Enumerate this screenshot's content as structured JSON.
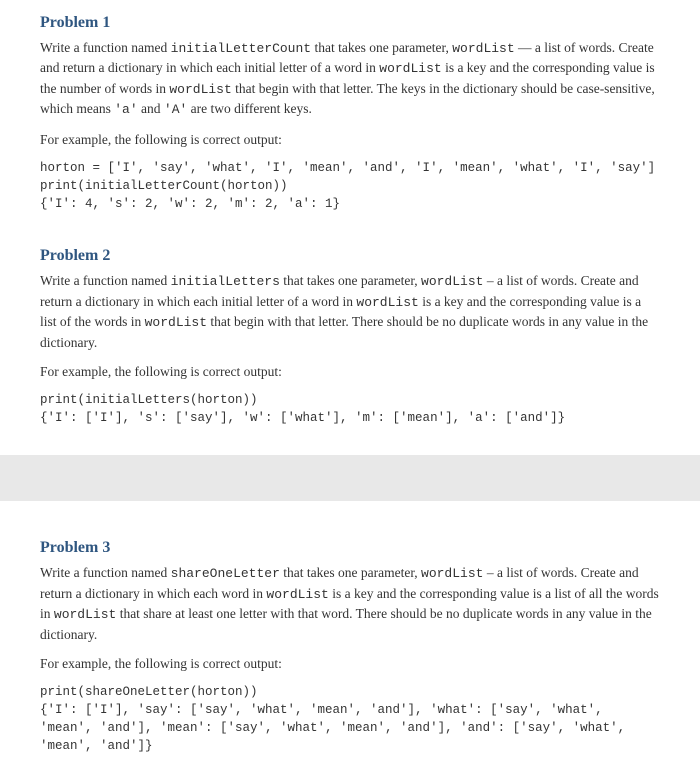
{
  "page1": {
    "problem1": {
      "title": "Problem 1",
      "text_a": "Write a function named ",
      "fn": "initialLetterCount",
      "text_b": " that takes one parameter, ",
      "param": "wordList",
      "text_c": " — a list of words. Create and return a dictionary in which each initial letter of a word in ",
      "param2": "wordList",
      "text_d": " is a key and the corresponding value is the number of words in ",
      "param3": "wordList",
      "text_e": " that begin with that letter. The keys in the dictionary should be case-sensitive, which means ",
      "lita": "'a'",
      "text_f": " and ",
      "litA": "'A'",
      "text_g": " are two different keys.",
      "example_intro": "For example, the following is correct output:",
      "code": "horton = ['I', 'say', 'what', 'I', 'mean', 'and', 'I', 'mean', 'what', 'I', 'say']\nprint(initialLetterCount(horton))\n{'I': 4, 's': 2, 'w': 2, 'm': 2, 'a': 1}"
    },
    "problem2": {
      "title": "Problem 2",
      "text_a": "Write a function named ",
      "fn": "initialLetters",
      "text_b": " that takes one parameter, ",
      "param": "wordList",
      "text_c": " – a list of words. Create and return a dictionary in which each initial letter of a word in ",
      "param2": "wordList",
      "text_d": " is a key and the corresponding value is a list of the words in ",
      "param3": "wordList",
      "text_e": " that begin with that letter. There should be no duplicate words in any value in the dictionary.",
      "example_intro": "For example, the following is correct output:",
      "code": "print(initialLetters(horton))\n{'I': ['I'], 's': ['say'], 'w': ['what'], 'm': ['mean'], 'a': ['and']}"
    }
  },
  "page2": {
    "problem3": {
      "title": "Problem 3",
      "text_a": "Write a function named ",
      "fn": "shareOneLetter",
      "text_b": " that takes one parameter, ",
      "param": "wordList",
      "text_c": " – a list of words. Create and return a dictionary in which each word in ",
      "param2": "wordList",
      "text_d": " is a key and the corresponding value is a list of all the words in ",
      "param3": "wordList",
      "text_e": " that share at least one letter with that word. There should be no duplicate words in any value in the dictionary.",
      "example_intro": "For example, the following is correct output:",
      "code": "print(shareOneLetter(horton))\n{'I': ['I'], 'say': ['say', 'what', 'mean', 'and'], 'what': ['say', 'what', 'mean', 'and'], 'mean': ['say', 'what', 'mean', 'and'], 'and': ['say', 'what', 'mean', 'and']}"
    }
  }
}
